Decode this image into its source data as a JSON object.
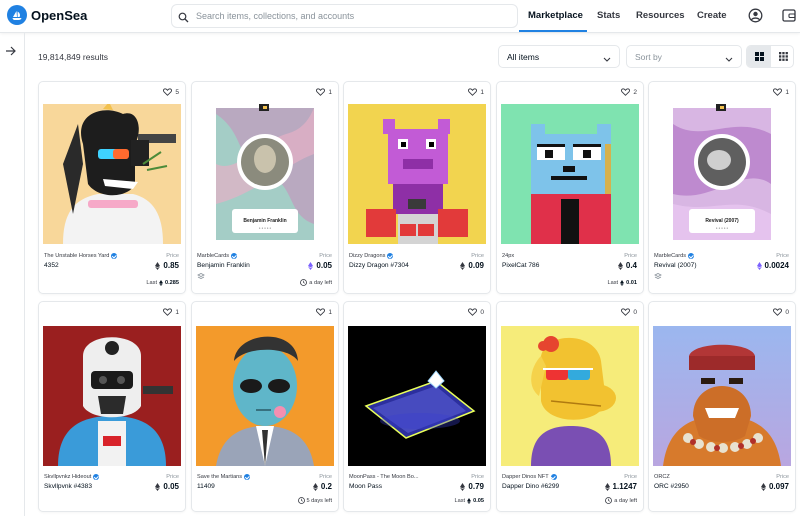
{
  "header": {
    "brand": "OpenSea",
    "search_placeholder": "Search items, collections, and accounts",
    "nav": [
      "Marketplace",
      "Stats",
      "Resources",
      "Create"
    ]
  },
  "toolbar": {
    "results": "19,814,849 results",
    "filter": "All items",
    "sort": "Sort by"
  },
  "colors": {
    "accent": "#2081e2",
    "text": "#04111d",
    "muted": "#8a939b"
  },
  "cards": [
    {
      "likes": "5",
      "collection": "The Unstable Horses Yard",
      "verified": true,
      "name": "4352",
      "price_label": "Price",
      "price": "0.85",
      "footer": "last",
      "last_label": "Last",
      "last": "0.285"
    },
    {
      "likes": "1",
      "collection": "MarbleCards",
      "verified": true,
      "name": "Benjamin Franklin",
      "price_label": "Price",
      "price": "0.05",
      "footer": "time",
      "time": "a day left",
      "art_title": "Benjamin Franklin"
    },
    {
      "likes": "1",
      "collection": "Dizzy Dragons",
      "verified": true,
      "name": "Dizzy Dragon #7304",
      "price_label": "Price",
      "price": "0.09",
      "footer": "none"
    },
    {
      "likes": "2",
      "collection": "24px",
      "verified": false,
      "name": "PixelCat 786",
      "price_label": "Price",
      "price": "0.4",
      "footer": "last",
      "last_label": "Last",
      "last": "0.01"
    },
    {
      "likes": "1",
      "collection": "MarbleCards",
      "verified": true,
      "name": "Revival (2007)",
      "price_label": "Price",
      "price": "0.0024",
      "footer": "none",
      "art_title": "Revival (2007)"
    },
    {
      "likes": "1",
      "collection": "Skvllpvnkz Hideout",
      "verified": true,
      "name": "Skvllpvnk #4383",
      "price_label": "Price",
      "price": "0.05",
      "footer": "none"
    },
    {
      "likes": "1",
      "collection": "Save the Martians",
      "verified": true,
      "name": "11409",
      "price_label": "Price",
      "price": "0.2",
      "footer": "time",
      "time": "5 days left"
    },
    {
      "likes": "0",
      "collection": "MoonPass - The Moon Bo...",
      "verified": false,
      "name": "Moon Pass",
      "price_label": "Price",
      "price": "0.79",
      "footer": "last",
      "last_label": "Last",
      "last": "0.05"
    },
    {
      "likes": "0",
      "collection": "Dapper Dinos NFT",
      "verified": true,
      "name": "Dapper Dino #6299",
      "price_label": "Price",
      "price": "1.1247",
      "footer": "time",
      "time": "a day left"
    },
    {
      "likes": "0",
      "collection": "ORCZ",
      "verified": false,
      "name": "ORC #2950",
      "price_label": "Price",
      "price": "0.097",
      "footer": "none"
    }
  ]
}
